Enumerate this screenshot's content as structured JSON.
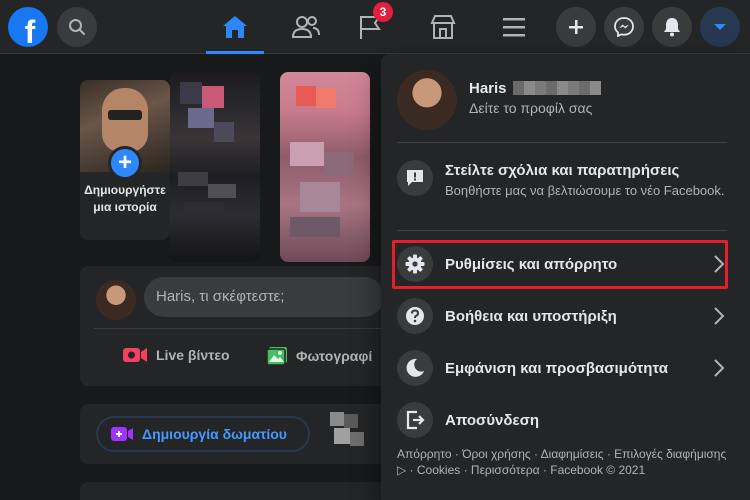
{
  "topbar": {
    "logo_letter": "f",
    "notifications_badge": "3",
    "active_tab": "home"
  },
  "stories": {
    "create_label": "Δημιουργήστε μια ιστορία",
    "create_plus": "+"
  },
  "composer": {
    "placeholder": "Haris, τι σκέφτεστε;",
    "actions": [
      {
        "label": "Live βίντεο",
        "icon": "live-video-icon",
        "color": "#f3425f"
      },
      {
        "label": "Φωτογραφί",
        "icon": "photo-icon",
        "color": "#45bd62"
      }
    ]
  },
  "rooms": {
    "create_room_label": "Δημιουργία δωματίου",
    "icon_color": "#a033ff"
  },
  "menu": {
    "profile": {
      "name": "Haris",
      "subtitle": "Δείτε το προφίλ σας"
    },
    "feedback": {
      "label": "Στείλτε σχόλια και παρατηρήσεις",
      "sub": "Βοηθήστε μας να βελτιώσουμε το νέο Facebook."
    },
    "items": [
      {
        "label": "Ρυθμίσεις και απόρρητο",
        "icon": "gear-icon"
      },
      {
        "label": "Βοήθεια και υποστήριξη",
        "icon": "help-icon"
      },
      {
        "label": "Εμφάνιση και προσβασιμότητα",
        "icon": "moon-icon"
      },
      {
        "label": "Αποσύνδεση",
        "icon": "logout-icon"
      }
    ],
    "footer": "Απόρρητο · Όροι χρήσης · Διαφημίσεις · Επιλογές διαφήμισης ▷ · Cookies · Περισσότερα · Facebook © 2021"
  },
  "colors": {
    "accent": "#2d88ff",
    "background": "#18191a",
    "surface": "#242526",
    "annotation_red": "#e41e2a"
  }
}
